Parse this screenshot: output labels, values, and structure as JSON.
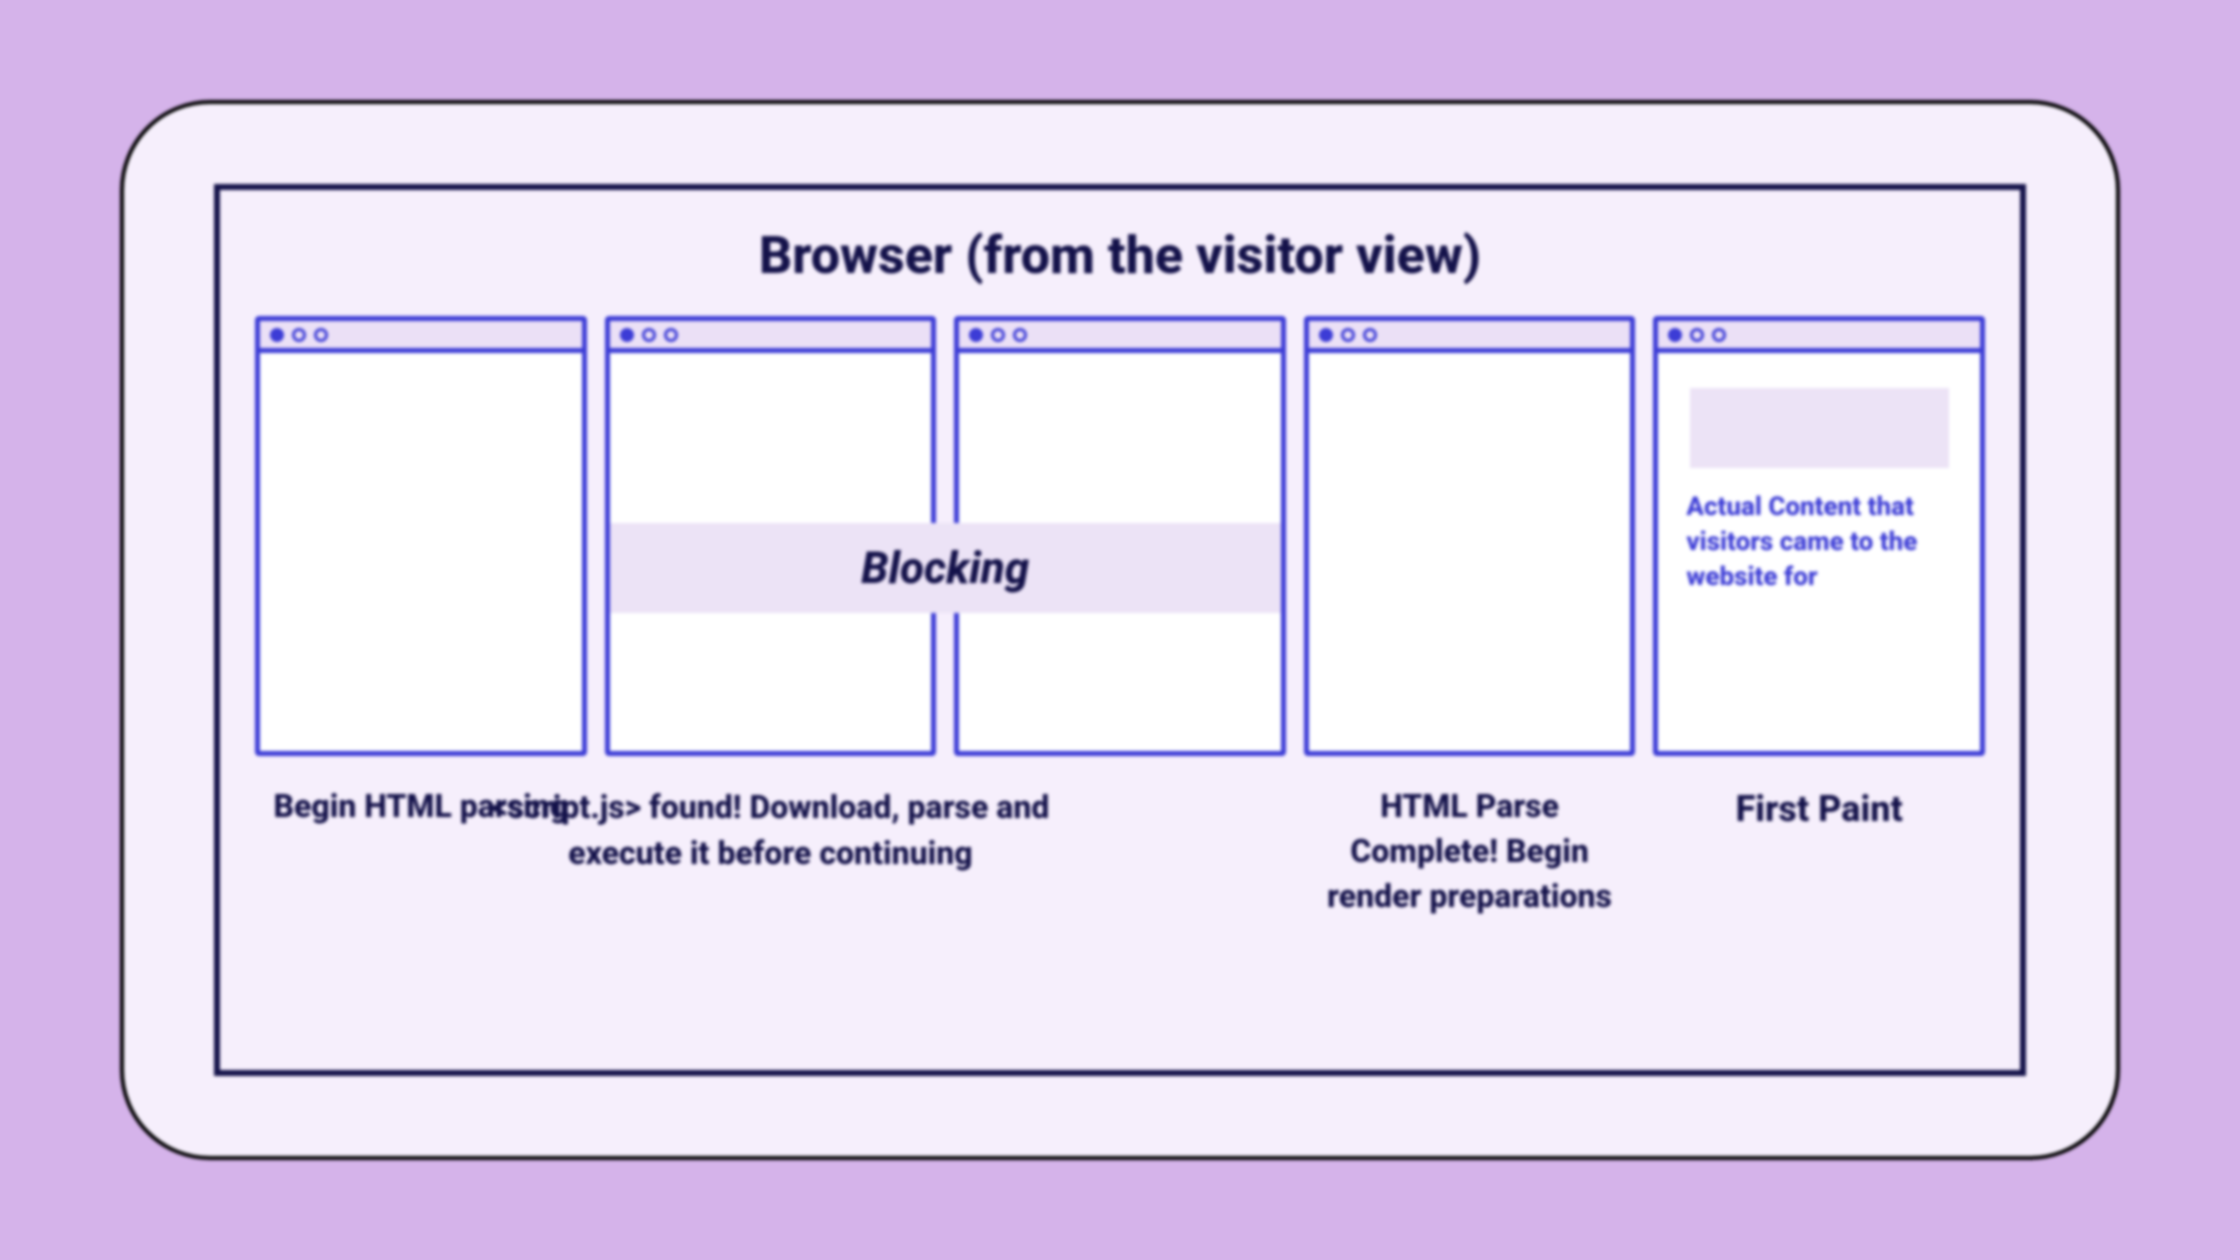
{
  "title": "Browser (from the visitor view)",
  "blocking_label": "Blocking",
  "stages": [
    {
      "caption": "Begin HTML parsing"
    },
    {
      "caption": "<script.js> found!\nDownload, parse and execute it before continuing"
    },
    {
      "caption": ""
    },
    {
      "caption": "HTML Parse Complete! Begin render preparations"
    },
    {
      "caption": "First Paint"
    }
  ],
  "first_paint_content": "Actual Content that visitors came to the website for"
}
